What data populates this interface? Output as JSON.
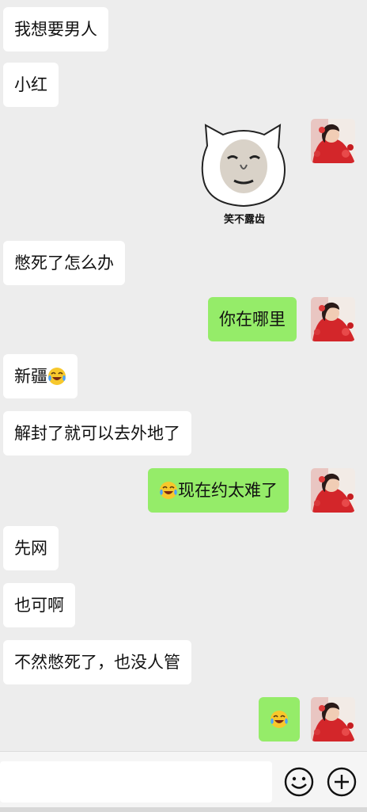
{
  "messages": [
    {
      "text": "我想要男人"
    },
    {
      "text": "小红"
    },
    {
      "sticker_caption": "笑不露齿"
    },
    {
      "text": "憋死了怎么办"
    },
    {
      "text": "你在哪里"
    },
    {
      "text": "新疆",
      "emoji": "crying-laugh-emoji"
    },
    {
      "text": "解封了就可以去外地了"
    },
    {
      "text": "现在约太难了",
      "emoji": "crying-laugh-emoji"
    },
    {
      "text": "先网"
    },
    {
      "text": "也可啊"
    },
    {
      "text": "不然憋死了，也没人管"
    },
    {
      "emoji": "crying-laugh-emoji"
    }
  ],
  "input_bar": {
    "input_value": "",
    "emoji_icon": "smiley-face-icon",
    "add_icon": "plus-circle-icon"
  },
  "colors": {
    "background": "#ededed",
    "incoming_bubble": "#ffffff",
    "outgoing_bubble": "#95ec69"
  }
}
